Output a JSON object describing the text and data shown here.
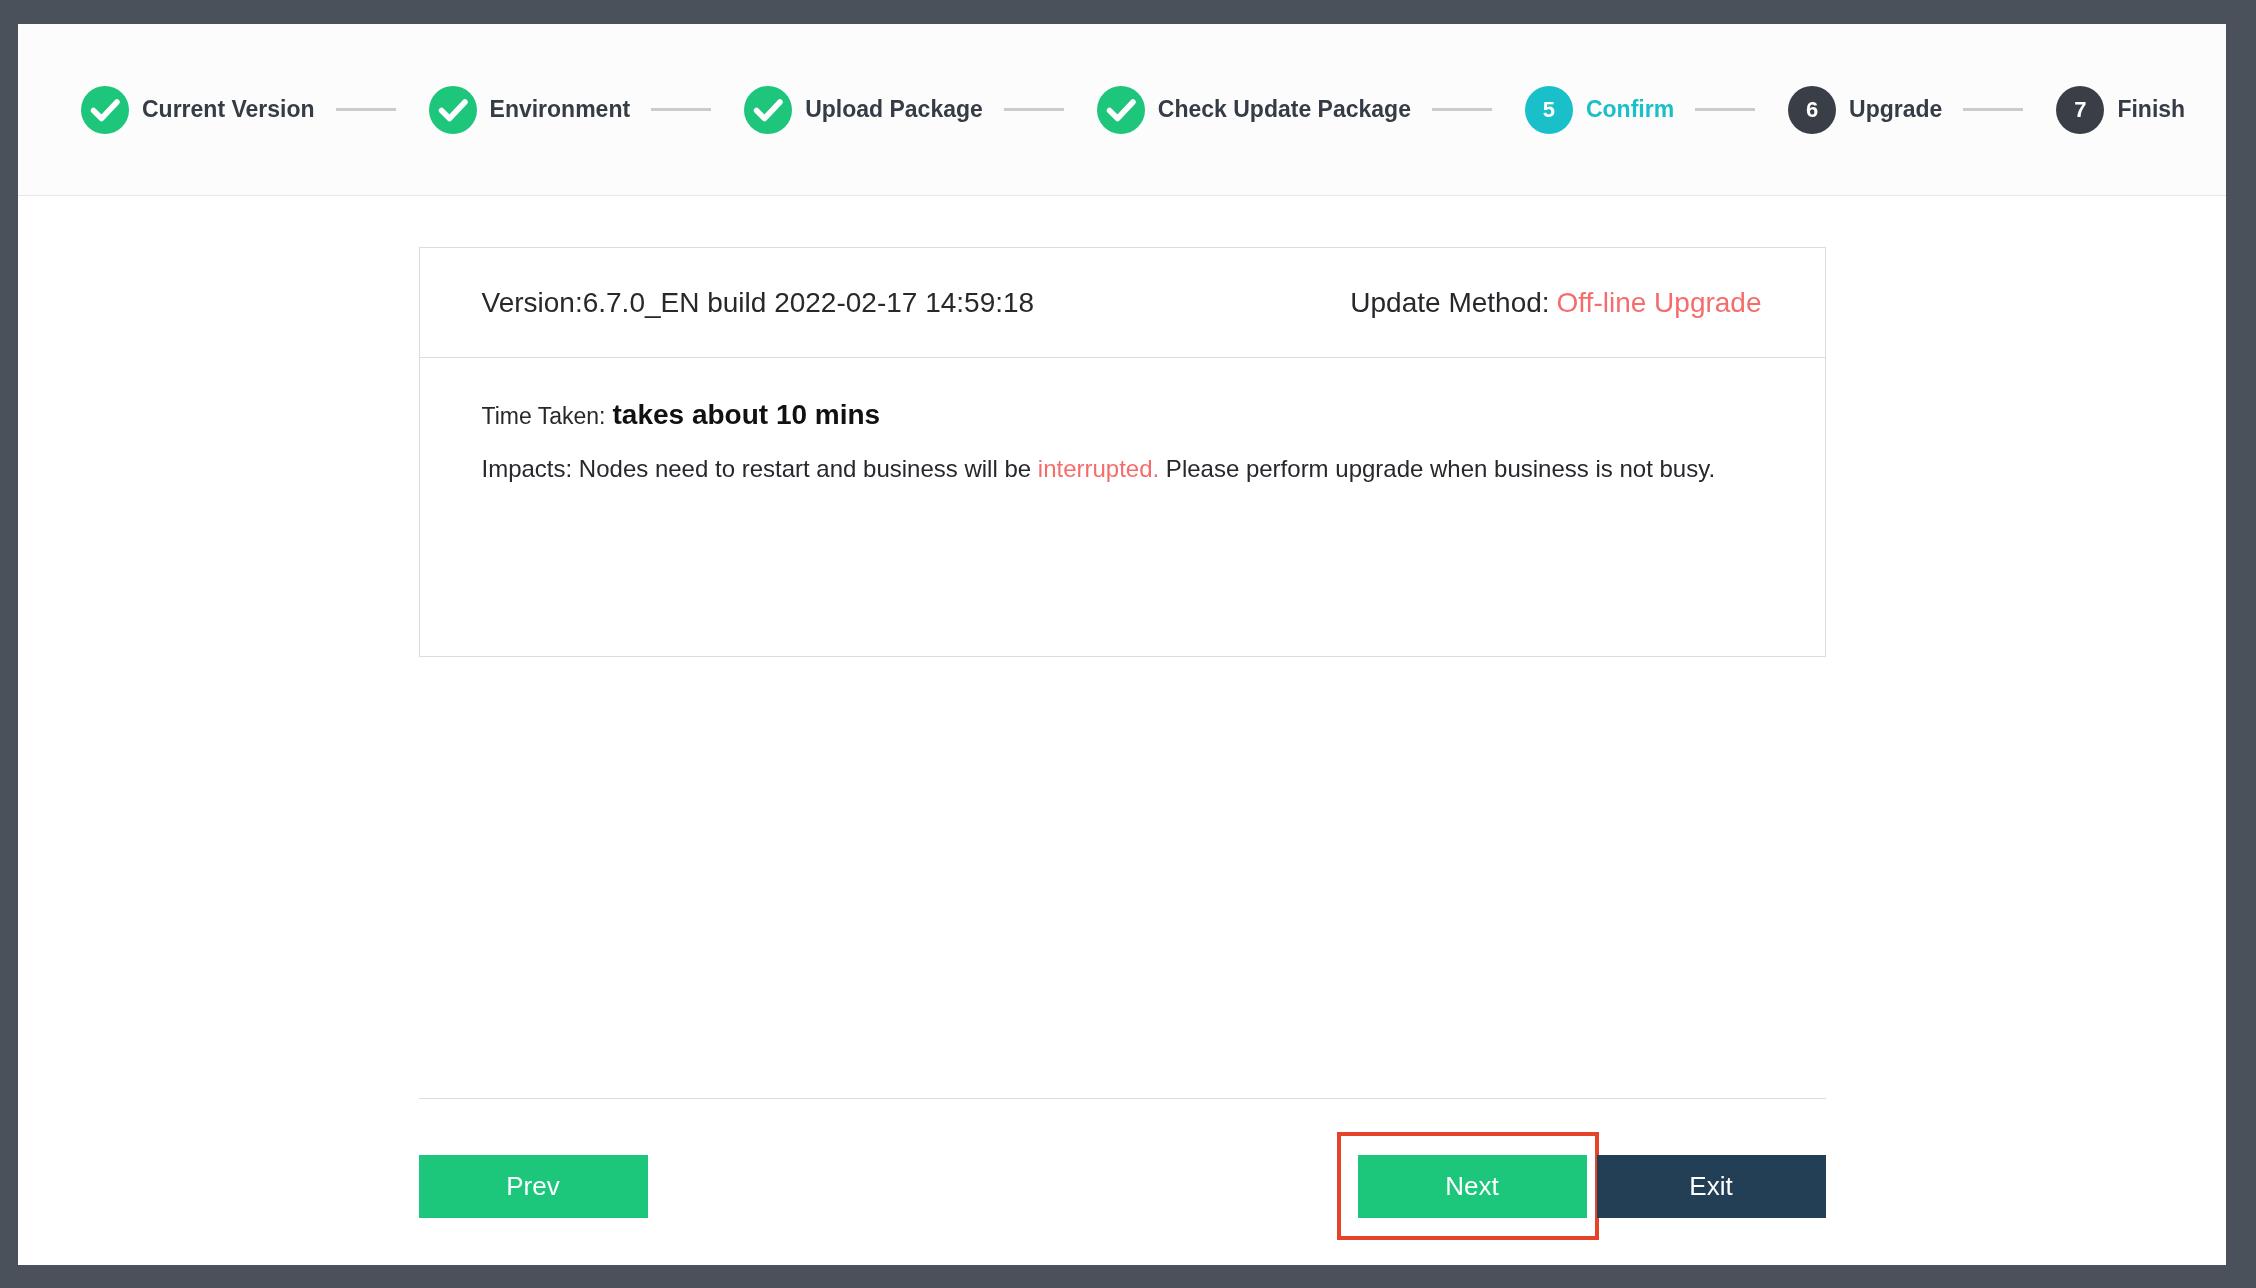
{
  "steps": [
    {
      "label": "Current Version",
      "completed": true,
      "active": false
    },
    {
      "label": "Environment",
      "completed": true,
      "active": false
    },
    {
      "label": "Upload Package",
      "completed": true,
      "active": false
    },
    {
      "label": "Check Update Package",
      "completed": true,
      "active": false
    },
    {
      "label": "Confirm",
      "completed": false,
      "active": true,
      "number": "5"
    },
    {
      "label": "Upgrade",
      "completed": false,
      "active": false,
      "number": "6"
    },
    {
      "label": "Finish",
      "completed": false,
      "active": false,
      "number": "7"
    }
  ],
  "summary": {
    "version": "Version:6.7.0_EN build 2022-02-17 14:59:18",
    "update_method": {
      "label": "Update Method:",
      "value": "Off-line Upgrade"
    }
  },
  "details": {
    "time_taken": {
      "label": "Time Taken:",
      "value": "takes about 10 mins"
    },
    "impacts": [
      {
        "text": "Impacts: Nodes need to restart and business will be ",
        "highlight": false
      },
      {
        "text": "interrupted.",
        "highlight": true
      },
      {
        "text": " Please perform upgrade when business is not busy.",
        "highlight": false
      }
    ]
  },
  "footer": {
    "left_buttons": [
      {
        "label": "Prev",
        "kind": "primary",
        "highlighted": false
      }
    ],
    "right_buttons": [
      {
        "label": "Next",
        "kind": "primary",
        "highlighted": true
      },
      {
        "label": "Exit",
        "kind": "dark",
        "highlighted": false
      }
    ]
  }
}
